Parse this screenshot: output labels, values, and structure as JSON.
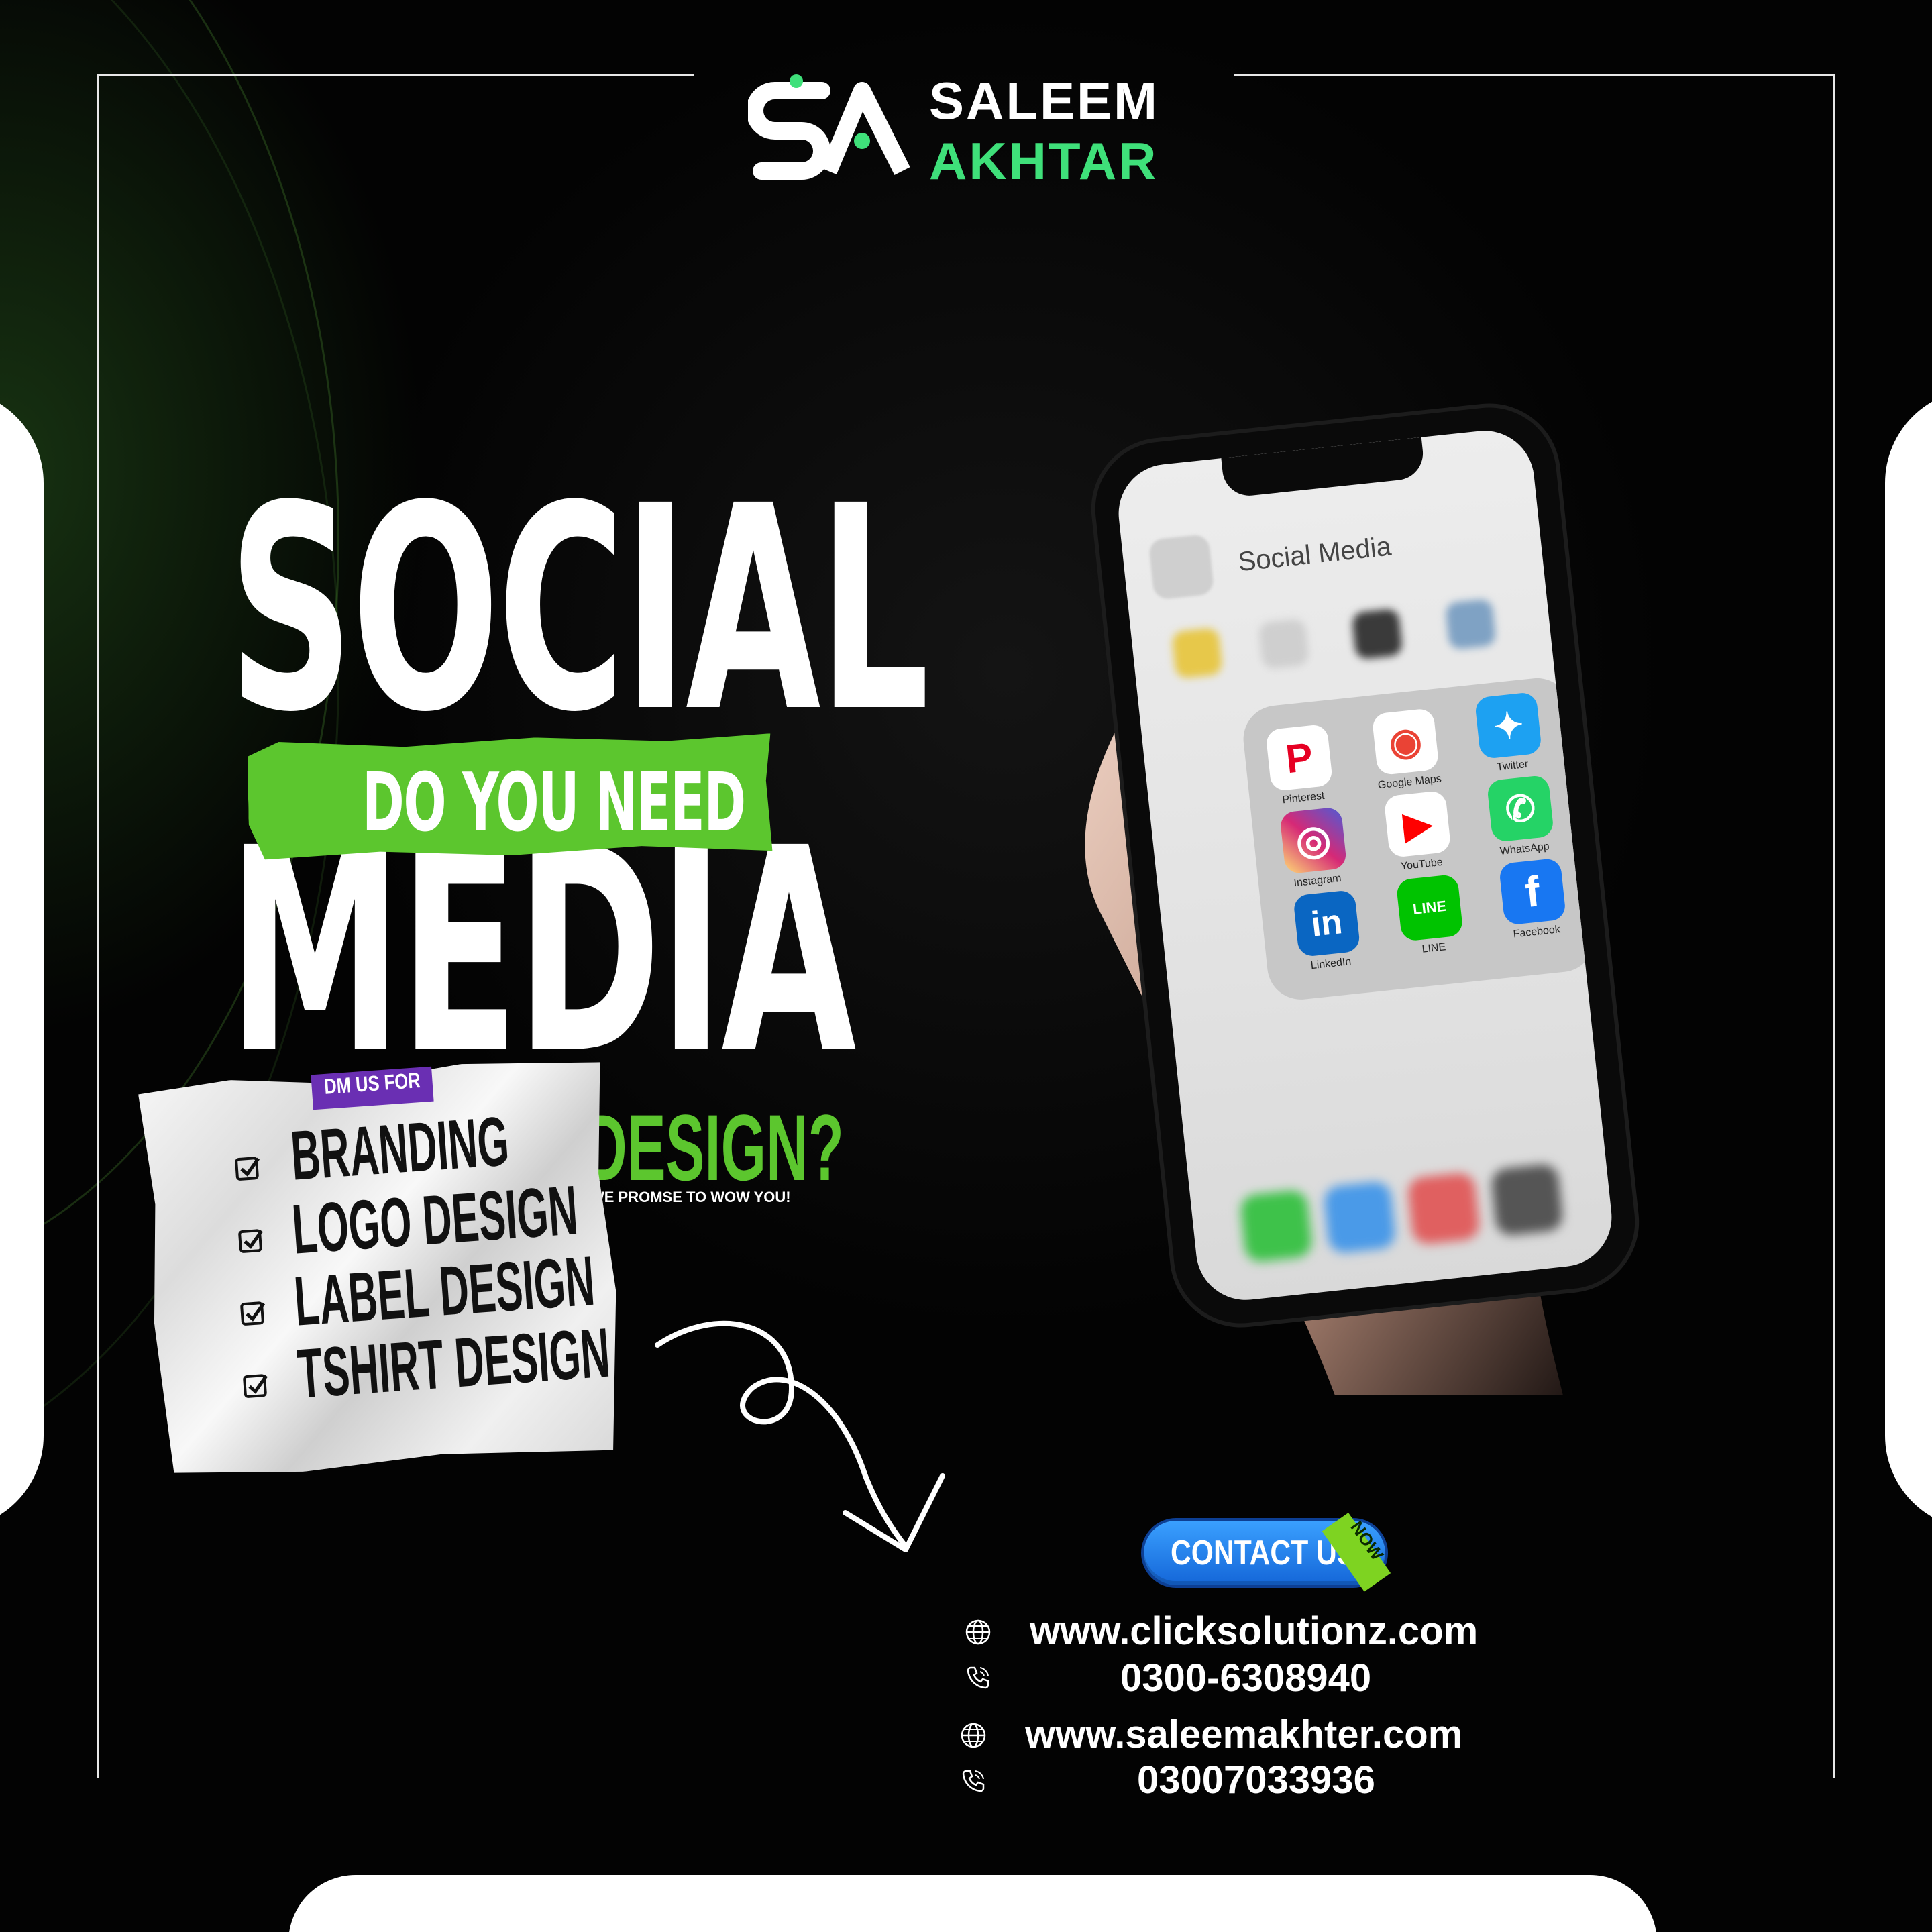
{
  "brand": {
    "name_top": "SALEEM",
    "name_bottom": "AKHTAR",
    "mark_letters": "SA",
    "accent_color": "#3fe07a"
  },
  "headline": {
    "word1": "SOCIAL",
    "word2": "MEDIA",
    "band_text": "DO YOU NEED",
    "design_text": "DESIGN?",
    "promise": "WE PROMSE TO WOW YOU!"
  },
  "services": {
    "tag": "DM US FOR",
    "items": [
      "BRANDING",
      "LOGO DESIGN",
      "LABEL DESIGN",
      "TSHIRT DESIGN"
    ]
  },
  "phone": {
    "folder_title": "Social Media",
    "apps": [
      {
        "label": "Pinterest",
        "icon": "pinterest-icon",
        "color": "#e60023",
        "bg": "#ffffff",
        "glyph": "P"
      },
      {
        "label": "Google Maps",
        "icon": "google-maps-icon",
        "color": "#ea4335",
        "bg": "#ffffff",
        "glyph": "◉"
      },
      {
        "label": "Twitter",
        "icon": "twitter-icon",
        "color": "#ffffff",
        "bg": "#1da1f2",
        "glyph": "✦"
      },
      {
        "label": "Instagram",
        "icon": "instagram-icon",
        "color": "#ffffff",
        "bg": "#d6249f",
        "glyph": "◎"
      },
      {
        "label": "YouTube",
        "icon": "youtube-icon",
        "color": "#ff0000",
        "bg": "#ffffff",
        "glyph": "▶"
      },
      {
        "label": "WhatsApp",
        "icon": "whatsapp-icon",
        "color": "#ffffff",
        "bg": "#25d366",
        "glyph": "✆"
      },
      {
        "label": "LinkedIn",
        "icon": "linkedin-icon",
        "color": "#ffffff",
        "bg": "#0a66c2",
        "glyph": "in"
      },
      {
        "label": "LINE",
        "icon": "line-icon",
        "color": "#00b900",
        "bg": "#00c300",
        "glyph": "LINE"
      },
      {
        "label": "Facebook",
        "icon": "facebook-icon",
        "color": "#ffffff",
        "bg": "#1877f2",
        "glyph": "f"
      }
    ]
  },
  "cta": {
    "label": "CONTACT US",
    "ribbon": "NOW"
  },
  "contacts": [
    {
      "type": "website",
      "icon": "globe-icon",
      "value": "www.clicksolutionz.com"
    },
    {
      "type": "phone",
      "icon": "phone-icon",
      "value": "0300-6308940"
    },
    {
      "type": "website",
      "icon": "globe-icon",
      "value": "www.saleemakhter.com"
    },
    {
      "type": "phone",
      "icon": "phone-icon",
      "value": "03007033936"
    }
  ],
  "colors": {
    "background": "#000000",
    "green": "#5cc62e",
    "purple": "#6a2fb3",
    "button_blue": "#1f7ff0"
  }
}
